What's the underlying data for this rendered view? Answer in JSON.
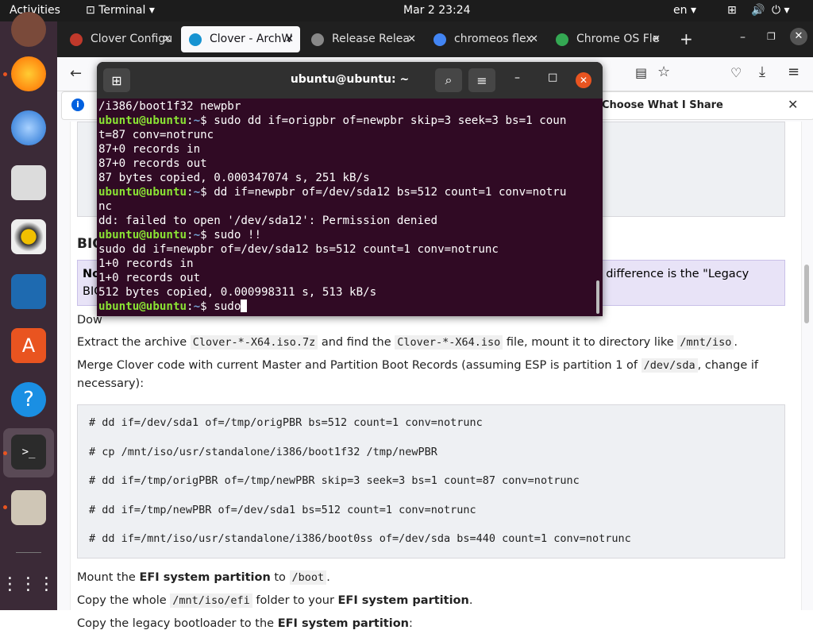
{
  "topbar": {
    "activities": "Activities",
    "app": "Terminal",
    "clock": "Mar 2  23:24",
    "lang": "en"
  },
  "browser": {
    "tabs": [
      {
        "label": "Clover Configu",
        "color": "#c0392b"
      },
      {
        "label": "Clover - ArchW",
        "color": "#1793d1"
      },
      {
        "label": "Release Relea",
        "color": "#888888"
      },
      {
        "label": "chromeos flex",
        "color": "#4285f4"
      },
      {
        "label": "Chrome OS Fle",
        "color": "#34a853"
      }
    ],
    "notify_text": "Choose What I Share"
  },
  "page": {
    "heading_partial": "BIO",
    "note_bold": "No",
    "note_tail": "y difference is the \"Legacy",
    "note_line2": "BIC",
    "dow": "Dow",
    "extract": {
      "pre": "Extract the archive ",
      "c1": "Clover-*-X64.iso.7z",
      "mid": " and find the ",
      "c2": "Clover-*-X64.iso",
      "post": " file, mount it to directory like ",
      "c3": "/mnt/iso",
      "end": "."
    },
    "merge1": {
      "pre": "Merge Clover code with current Master and Partition Boot Records (assuming ESP is partition 1 of ",
      "c1": "/dev/sda",
      "post": ", change if"
    },
    "merge2": "necessary):",
    "code_lines": [
      "# dd if=/dev/sda1 of=/tmp/origPBR bs=512 count=1 conv=notrunc",
      "# cp /mnt/iso/usr/standalone/i386/boot1f32 /tmp/newPBR",
      "# dd if=/tmp/origPBR of=/tmp/newPBR skip=3 seek=3 bs=1 count=87 conv=notrunc",
      "# dd if=/tmp/newPBR of=/dev/sda1 bs=512 count=1 conv=notrunc",
      "# dd if=/mnt/iso/usr/standalone/i386/boot0ss of=/dev/sda bs=440 count=1 conv=notrunc"
    ],
    "mount": {
      "pre": "Mount the ",
      "b": "EFI system partition",
      "mid": " to ",
      "c": "/boot",
      "end": "."
    },
    "copy": {
      "pre": "Copy the whole ",
      "c": "/mnt/iso/efi",
      "mid": " folder to your ",
      "b": "EFI system partition",
      "end": "."
    },
    "legacy": {
      "pre": "Copy the legacy bootloader to the ",
      "b": "EFI system partition",
      "end": ":"
    }
  },
  "terminal": {
    "title": "ubuntu@ubuntu: ~",
    "prompt": "ubuntu@ubuntu",
    "lines": [
      {
        "t": "/i386/boot1f32 newpbr"
      },
      {
        "p": true,
        "cmd": "sudo dd if=origpbr of=newpbr skip=3 seek=3 bs=1 coun"
      },
      {
        "t": "t=87 conv=notrunc"
      },
      {
        "t": "87+0 records in"
      },
      {
        "t": "87+0 records out"
      },
      {
        "t": "87 bytes copied, 0.000347074 s, 251 kB/s"
      },
      {
        "p": true,
        "cmd": "dd if=newpbr of=/dev/sda12 bs=512 count=1 conv=notru"
      },
      {
        "t": "nc"
      },
      {
        "t": "dd: failed to open '/dev/sda12': Permission denied"
      },
      {
        "p": true,
        "cmd": "sudo !!"
      },
      {
        "t": "sudo dd if=newpbr of=/dev/sda12 bs=512 count=1 conv=notrunc"
      },
      {
        "t": "1+0 records in"
      },
      {
        "t": "1+0 records out"
      },
      {
        "t": "512 bytes copied, 0.000998311 s, 513 kB/s"
      },
      {
        "p": true,
        "cmd": "sudo",
        "cursor": true
      }
    ]
  }
}
